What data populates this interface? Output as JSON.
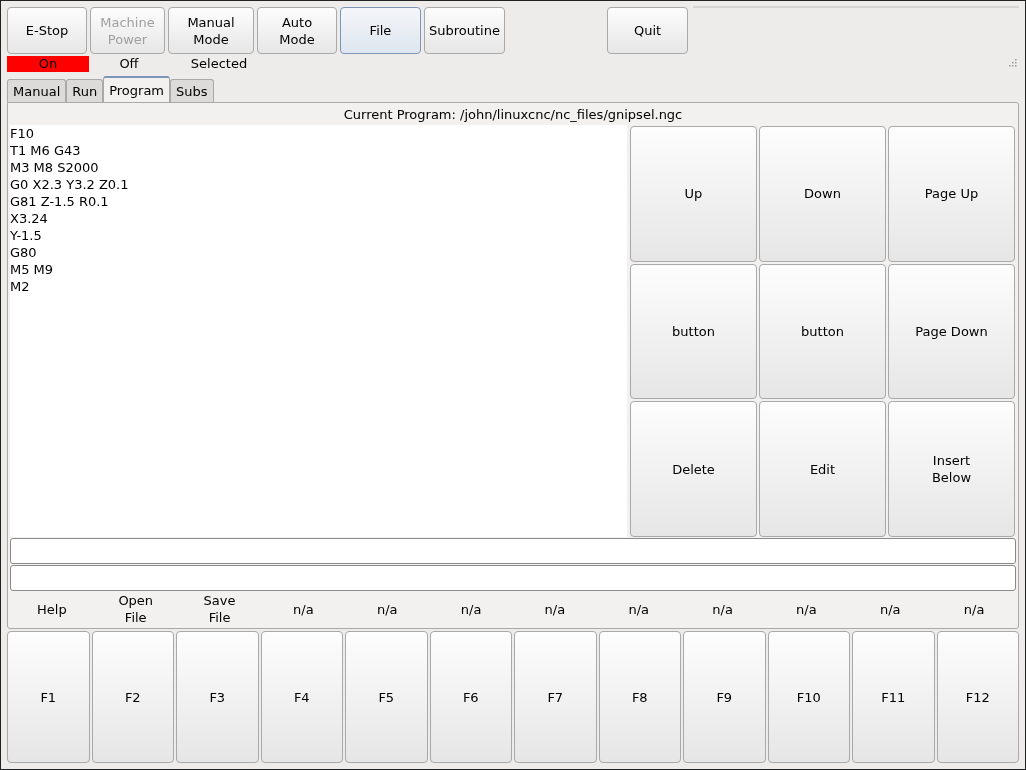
{
  "toolbar": {
    "buttons": [
      {
        "label": "E-Stop",
        "disabled": false,
        "selected": false
      },
      {
        "label": "Machine\nPower",
        "disabled": true,
        "selected": false
      },
      {
        "label": "Manual\nMode",
        "disabled": false,
        "selected": false
      },
      {
        "label": "Auto\nMode",
        "disabled": false,
        "selected": false
      },
      {
        "label": "File",
        "disabled": false,
        "selected": true
      },
      {
        "label": "Subroutine",
        "disabled": false,
        "selected": false
      }
    ],
    "quit": "Quit"
  },
  "status": [
    {
      "text": "On",
      "alert": true
    },
    {
      "text": "Off",
      "alert": false
    },
    {
      "text": "Selected",
      "alert": false
    }
  ],
  "tabs": [
    {
      "label": "Manual",
      "selected": false
    },
    {
      "label": "Run",
      "selected": false
    },
    {
      "label": "Program",
      "selected": true
    },
    {
      "label": "Subs",
      "selected": false
    }
  ],
  "program": {
    "title": "Current Program: /john/linuxcnc/nc_files/gnipsel.ngc",
    "lines": [
      "F10",
      "T1 M6 G43",
      "M3 M8 S2000",
      "G0 X2.3 Y3.2 Z0.1",
      "G81 Z-1.5 R0.1",
      "X3.24",
      "Y-1.5",
      "G80",
      "M5 M9",
      "M2"
    ],
    "button_rows": [
      [
        "Up",
        "Down",
        "Page Up"
      ],
      [
        "button",
        "button",
        "Page Down"
      ],
      [
        "Delete",
        "Edit",
        "Insert\nBelow"
      ]
    ]
  },
  "function_labels": [
    "Help",
    "Open\nFile",
    "Save\nFile",
    "n/a",
    "n/a",
    "n/a",
    "n/a",
    "n/a",
    "n/a",
    "n/a",
    "n/a",
    "n/a"
  ],
  "function_keys": [
    "F1",
    "F2",
    "F3",
    "F4",
    "F5",
    "F6",
    "F7",
    "F8",
    "F9",
    "F10",
    "F11",
    "F12"
  ]
}
